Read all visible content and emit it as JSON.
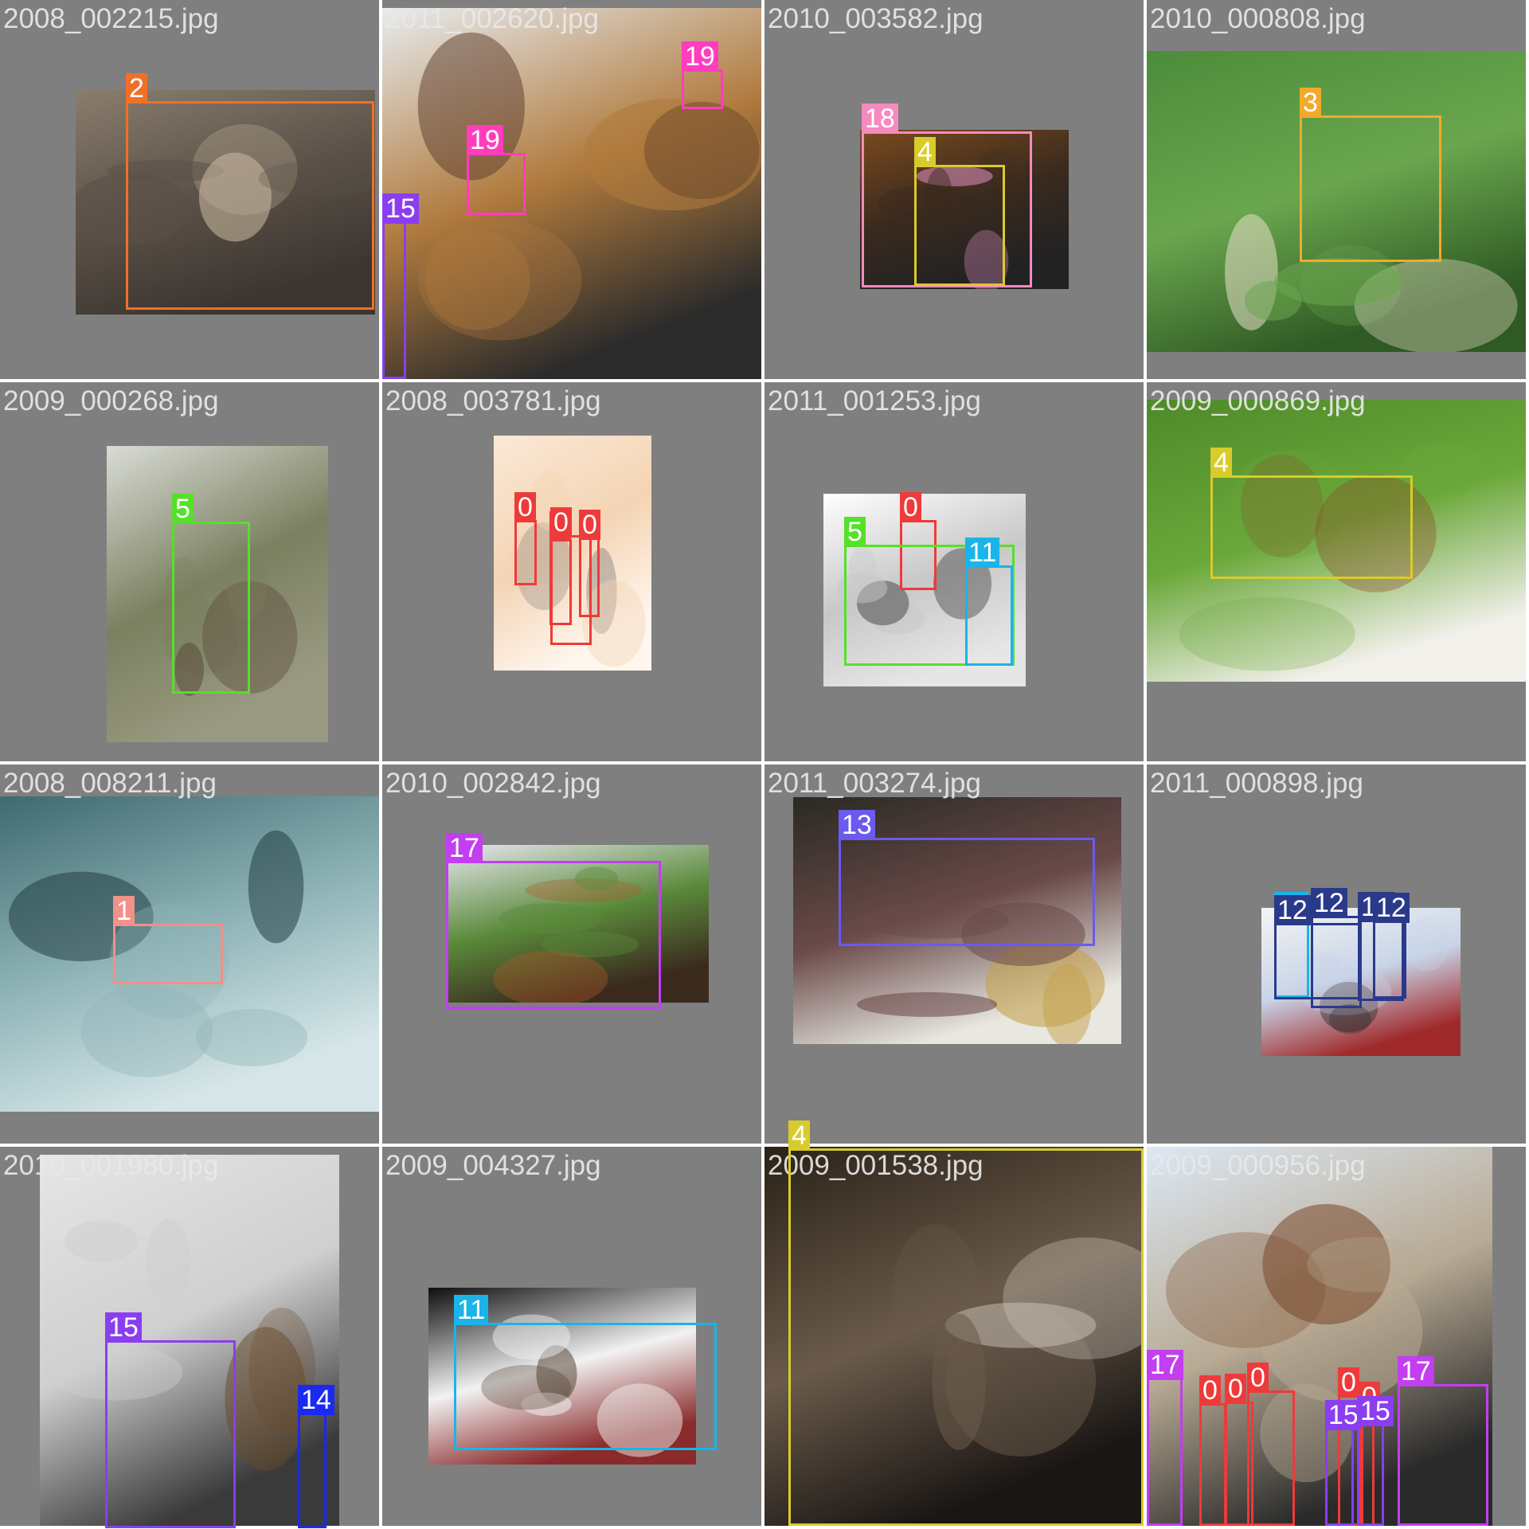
{
  "tiles": [
    {
      "filename": "2008_002215.jpg",
      "photo_palette": [
        "#8a7d6e",
        "#5b5148",
        "#c9b9a0",
        "#3c3630"
      ],
      "boxes": [
        {
          "label": "2",
          "color": "#f07028"
        }
      ]
    },
    {
      "filename": "2011_002620.jpg",
      "photo_palette": [
        "#e8ecef",
        "#b07a3d",
        "#5a3a2a",
        "#2b2b2b"
      ],
      "boxes": [
        {
          "label": "19",
          "color": "#ff3dbd"
        },
        {
          "label": "19",
          "color": "#ff3dbd"
        },
        {
          "label": "15",
          "color": "#8a3ef0"
        }
      ]
    },
    {
      "filename": "2010_003582.jpg",
      "photo_palette": [
        "#7a4a1e",
        "#3a2a1e",
        "#d98fc0",
        "#222222"
      ],
      "boxes": [
        {
          "label": "18",
          "color": "#f58ac0"
        },
        {
          "label": "4",
          "color": "#d8cc2a"
        }
      ]
    },
    {
      "filename": "2010_000808.jpg",
      "photo_palette": [
        "#4c8c3a",
        "#6aa64e",
        "#e8e0c8",
        "#2f5a24"
      ],
      "boxes": [
        {
          "label": "3",
          "color": "#f2aa2a"
        }
      ]
    },
    {
      "filename": "2009_000268.jpg",
      "photo_palette": [
        "#d9dcd6",
        "#7b8060",
        "#5a4a3a",
        "#9a9a82"
      ],
      "boxes": [
        {
          "label": "5",
          "color": "#55e02a"
        }
      ]
    },
    {
      "filename": "2008_003781.jpg",
      "photo_palette": [
        "#fbe9d6",
        "#f4d4b4",
        "#6a6a6a",
        "#fff6ee"
      ],
      "boxes": [
        {
          "label": "0",
          "color": "#ee3a3a"
        },
        {
          "label": "0",
          "color": "#ee3a3a"
        },
        {
          "label": "0",
          "color": "#ee3a3a"
        },
        {
          "label": "0",
          "color": "#ee3a3a"
        }
      ]
    },
    {
      "filename": "2011_001253.jpg",
      "photo_palette": [
        "#ffffff",
        "#c8c8c8",
        "#4a4a4a",
        "#e6e6e6"
      ],
      "boxes": [
        {
          "label": "0",
          "color": "#ee3a3a"
        },
        {
          "label": "5",
          "color": "#55e02a"
        },
        {
          "label": "11",
          "color": "#1ab4e8"
        }
      ]
    },
    {
      "filename": "2009_000869.jpg",
      "photo_palette": [
        "#4f8a2a",
        "#6ba83a",
        "#8a4a24",
        "#f2f0ea"
      ],
      "boxes": [
        {
          "label": "4",
          "color": "#d8cc2a"
        }
      ]
    },
    {
      "filename": "2008_008211.jpg",
      "photo_palette": [
        "#3f6a6e",
        "#8fb4b8",
        "#1f3a3e",
        "#d6e6e8"
      ],
      "boxes": [
        {
          "label": "1",
          "color": "#f2908a"
        }
      ]
    },
    {
      "filename": "2010_002842.jpg",
      "photo_palette": [
        "#e8e8f0",
        "#5a8a3a",
        "#b05a2a",
        "#3a2a1e"
      ],
      "boxes": [
        {
          "label": "17",
          "color": "#c23ef0"
        }
      ]
    },
    {
      "filename": "2011_003274.jpg",
      "photo_palette": [
        "#2a2a22",
        "#6a4a4a",
        "#c4a04a",
        "#e8e8e0"
      ],
      "boxes": [
        {
          "label": "13",
          "color": "#6a5af0"
        }
      ]
    },
    {
      "filename": "2011_000898.jpg",
      "photo_palette": [
        "#f4f4f4",
        "#c8d4e8",
        "#2a2a2a",
        "#a02a2a"
      ],
      "boxes": [
        {
          "label": "11",
          "color": "#1ab4e8"
        },
        {
          "label": "12",
          "color": "#2a3a8a"
        },
        {
          "label": "12",
          "color": "#2a3a8a"
        },
        {
          "label": "12",
          "color": "#2a3a8a"
        },
        {
          "label": "12",
          "color": "#2a3a8a"
        }
      ]
    },
    {
      "filename": "2010_001980.jpg",
      "photo_palette": [
        "#e6e6e6",
        "#cfcfcf",
        "#6a4a2a",
        "#3a3a3a"
      ],
      "boxes": [
        {
          "label": "15",
          "color": "#8a3ef0"
        },
        {
          "label": "14",
          "color": "#1a2af0"
        }
      ]
    },
    {
      "filename": "2009_004327.jpg",
      "photo_palette": [
        "#0e0e0e",
        "#f2f2f2",
        "#4a3a2a",
        "#8a2a2a"
      ],
      "boxes": [
        {
          "label": "11",
          "color": "#1ab4e8"
        }
      ]
    },
    {
      "filename": "2009_001538.jpg",
      "photo_palette": [
        "#2a2218",
        "#6a5a4a",
        "#cfc8bc",
        "#1a1614"
      ],
      "boxes": [
        {
          "label": "4",
          "color": "#d8cc2a"
        }
      ]
    },
    {
      "filename": "2009_000956.jpg",
      "photo_palette": [
        "#dce8f4",
        "#b8aa94",
        "#7a4a2a",
        "#2a2a2a"
      ],
      "boxes": [
        {
          "label": "17",
          "color": "#c23ef0"
        },
        {
          "label": "0",
          "color": "#ee3a3a"
        },
        {
          "label": "0",
          "color": "#ee3a3a"
        },
        {
          "label": "0",
          "color": "#ee3a3a"
        },
        {
          "label": "0",
          "color": "#ee3a3a"
        },
        {
          "label": "0",
          "color": "#ee3a3a"
        },
        {
          "label": "17",
          "color": "#c23ef0"
        },
        {
          "label": "15",
          "color": "#8a3ef0"
        },
        {
          "label": "15",
          "color": "#8a3ef0"
        }
      ]
    }
  ]
}
